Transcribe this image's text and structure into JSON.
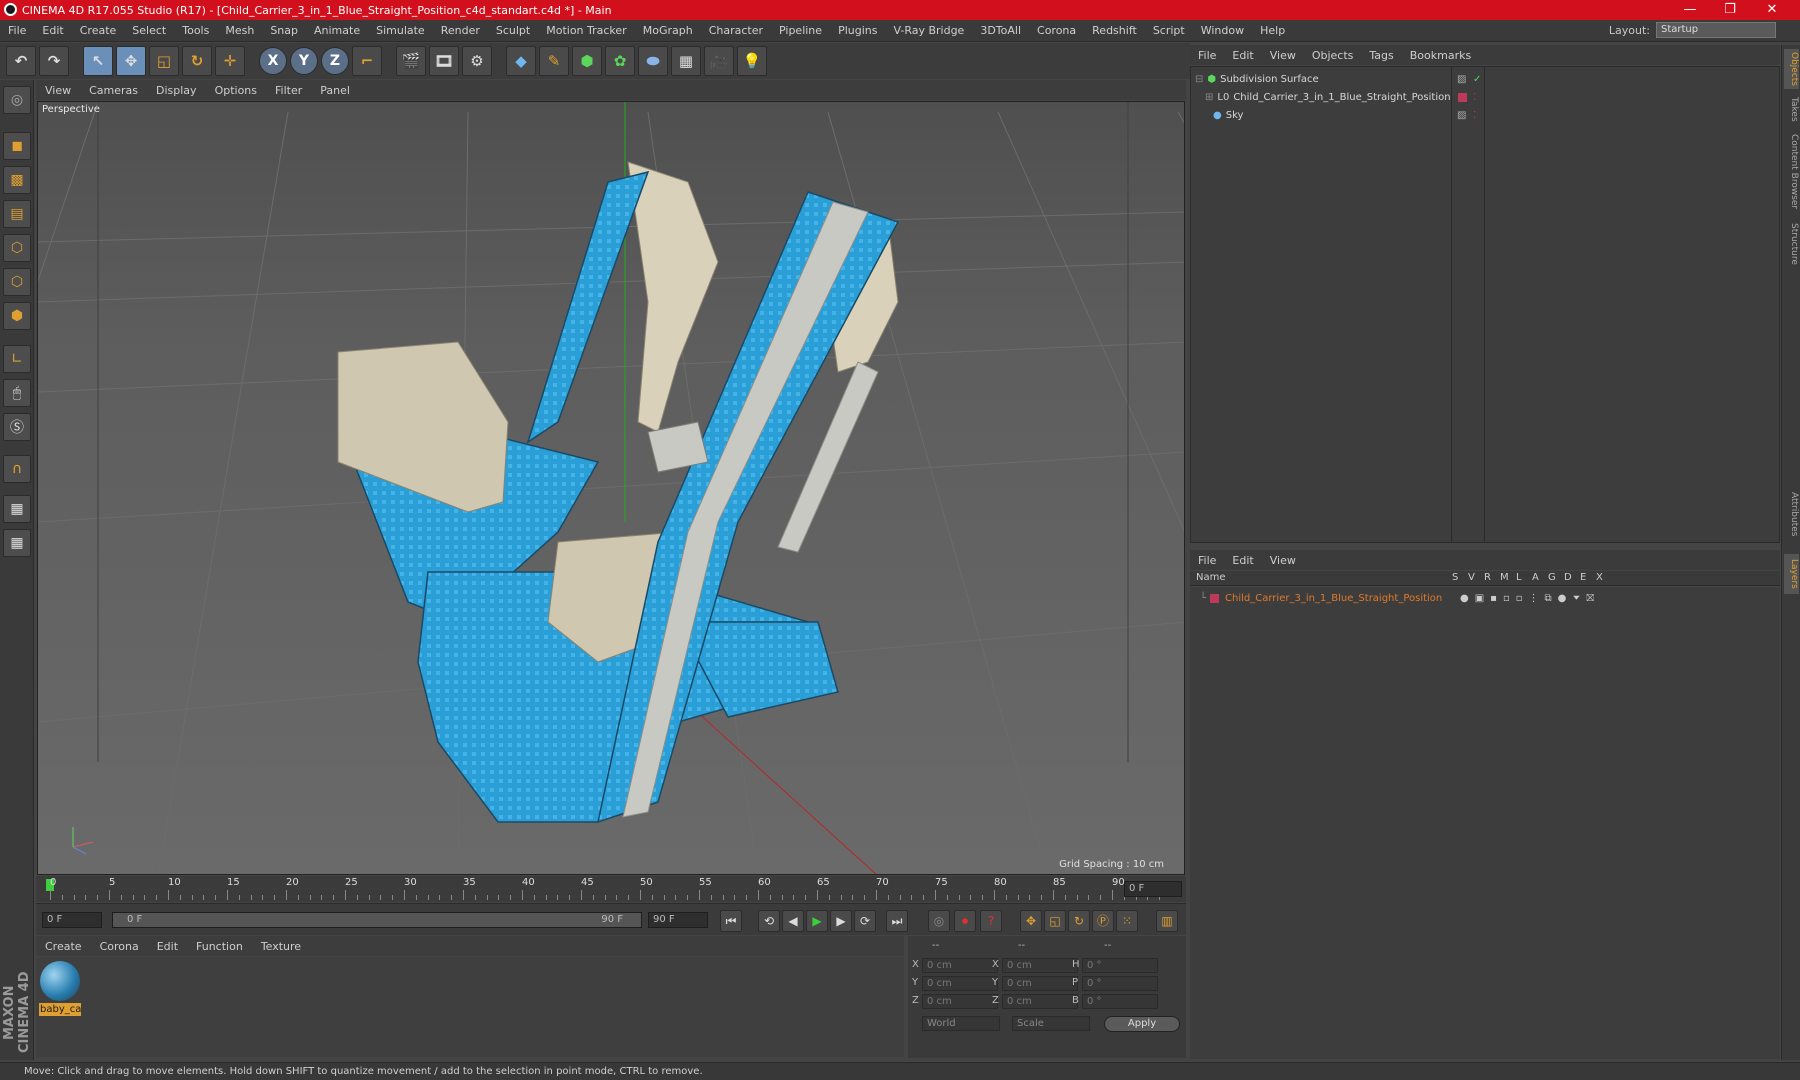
{
  "window": {
    "title": "CINEMA 4D R17.055 Studio (R17) - [Child_Carrier_3_in_1_Blue_Straight_Position_c4d_standart.c4d *] - Main",
    "minimize": "—",
    "maximize": "❐",
    "close": "✕"
  },
  "menubar": {
    "items": [
      "File",
      "Edit",
      "Create",
      "Select",
      "Tools",
      "Mesh",
      "Snap",
      "Animate",
      "Simulate",
      "Render",
      "Sculpt",
      "Motion Tracker",
      "MoGraph",
      "Character",
      "Pipeline",
      "Plugins",
      "V-Ray Bridge",
      "3DToAll",
      "Corona",
      "Redshift",
      "Script",
      "Window",
      "Help"
    ],
    "layout_label": "Layout:",
    "layout_value": "Startup"
  },
  "toolbar": {
    "undo": "↶",
    "redo": "↷",
    "live_select": "↖",
    "move": "✥",
    "scale": "◱",
    "rotate": "↻",
    "transform": "✛",
    "x": "X",
    "y": "Y",
    "z": "Z",
    "coord": "⌐"
  },
  "viewport": {
    "menu": [
      "View",
      "Cameras",
      "Display",
      "Options",
      "Filter",
      "Panel"
    ],
    "label": "Perspective",
    "grid_spacing": "Grid Spacing : 10 cm"
  },
  "timeline": {
    "ticks": [
      "0",
      "5",
      "10",
      "15",
      "20",
      "25",
      "30",
      "35",
      "40",
      "45",
      "50",
      "55",
      "60",
      "65",
      "70",
      "75",
      "80",
      "85",
      "90"
    ],
    "current_frame": "0 F",
    "start_frame": "0 F",
    "range_start": "0 F",
    "range_end": "90 F",
    "end_frame": "90 F"
  },
  "materials": {
    "menu": [
      "Create",
      "Corona",
      "Edit",
      "Function",
      "Texture"
    ],
    "items": [
      {
        "name": "baby_ca"
      }
    ]
  },
  "coordinates": {
    "header": [
      "--",
      "--",
      "--"
    ],
    "rows": [
      {
        "a": "X",
        "av": "0 cm",
        "b": "X",
        "bv": "0 cm",
        "c": "H",
        "cv": "0 °"
      },
      {
        "a": "Y",
        "av": "0 cm",
        "b": "Y",
        "bv": "0 cm",
        "c": "P",
        "cv": "0 °"
      },
      {
        "a": "Z",
        "av": "0 cm",
        "b": "Z",
        "bv": "0 cm",
        "c": "B",
        "cv": "0 °"
      }
    ],
    "world": "World",
    "scale": "Scale",
    "apply": "Apply"
  },
  "objects": {
    "menu": [
      "File",
      "Edit",
      "View",
      "Objects",
      "Tags",
      "Bookmarks"
    ],
    "items": [
      {
        "name": "Subdivision Surface"
      },
      {
        "name": "Child_Carrier_3_in_1_Blue_Straight_Position"
      },
      {
        "name": "Sky"
      }
    ]
  },
  "layers": {
    "menu": [
      "File",
      "Edit",
      "View"
    ],
    "columns": [
      "Name",
      "S",
      "V",
      "R",
      "M",
      "L",
      "A",
      "G",
      "D",
      "E",
      "X"
    ],
    "items": [
      {
        "name": "Child_Carrier_3_in_1_Blue_Straight_Position",
        "color": "#e07a2a"
      }
    ]
  },
  "right_tabs": [
    "Objects",
    "Takes",
    "Content Browser",
    "Structure",
    "Attributes",
    "Layers"
  ],
  "status": "Move: Click and drag to move elements. Hold down SHIFT to quantize movement / add to the selection in point mode, CTRL to remove.",
  "brand": "MAXON CINEMA 4D"
}
